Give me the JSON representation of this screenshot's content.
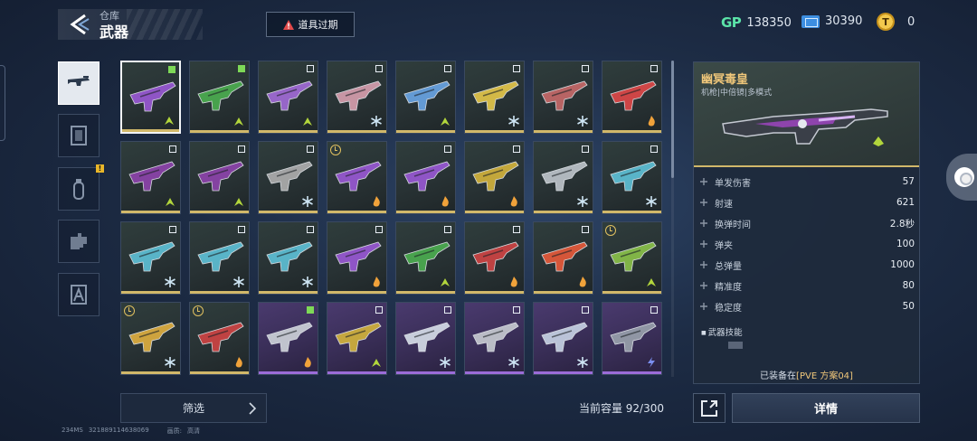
{
  "header": {
    "subtitle": "仓库",
    "title": "武器",
    "expired_label": "道具过期"
  },
  "currency": {
    "gp_label": "GP",
    "gp_value": "138350",
    "ticket_value": "30390",
    "coin_value": "0"
  },
  "categories": [
    {
      "icon": "rifle-icon",
      "active": true
    },
    {
      "icon": "frame-icon",
      "active": false
    },
    {
      "icon": "grenade-icon",
      "active": false,
      "badge": "!"
    },
    {
      "icon": "puzzle-icon",
      "active": false
    },
    {
      "icon": "character-icon",
      "active": false
    }
  ],
  "grid": {
    "items": [
      {
        "selected": true,
        "corner": "green",
        "elem": "poison",
        "rarity": "gold",
        "color": "#9b59d6"
      },
      {
        "corner": "green",
        "elem": "poison",
        "rarity": "gold",
        "color": "#4caf50"
      },
      {
        "corner": "empty",
        "elem": "poison",
        "rarity": "gold",
        "color": "#a36cd9"
      },
      {
        "corner": "empty",
        "elem": "ice",
        "rarity": "gold",
        "color": "#d9a0b0"
      },
      {
        "corner": "empty",
        "elem": "poison",
        "rarity": "gold",
        "color": "#6aa6e6"
      },
      {
        "corner": "empty",
        "elem": "ice",
        "rarity": "gold",
        "color": "#e6c84a"
      },
      {
        "corner": "empty",
        "elem": "ice",
        "rarity": "gold",
        "color": "#c86a6a"
      },
      {
        "corner": "empty",
        "elem": "fire",
        "rarity": "gold",
        "color": "#e04848"
      },
      {
        "corner": "empty",
        "elem": "poison",
        "rarity": "gold",
        "color": "#8e44ad"
      },
      {
        "corner": "empty",
        "elem": "poison",
        "rarity": "gold",
        "color": "#8e44ad"
      },
      {
        "corner": "empty",
        "elem": "ice",
        "rarity": "gold",
        "color": "#b0b0b0"
      },
      {
        "clock": true,
        "elem": "fire",
        "rarity": "gold",
        "color": "#9b59d6"
      },
      {
        "corner": "empty",
        "elem": "fire",
        "rarity": "gold",
        "color": "#9b59d6"
      },
      {
        "corner": "empty",
        "elem": "fire",
        "rarity": "gold",
        "color": "#d4b43c"
      },
      {
        "corner": "empty",
        "elem": "ice",
        "rarity": "gold",
        "color": "#bfc6cc"
      },
      {
        "corner": "empty",
        "elem": "ice",
        "rarity": "gold",
        "color": "#5fc2d8"
      },
      {
        "corner": "empty",
        "elem": "ice",
        "rarity": "gold",
        "color": "#5fc2d8"
      },
      {
        "corner": "empty",
        "elem": "ice",
        "rarity": "gold",
        "color": "#5fc2d8"
      },
      {
        "corner": "empty",
        "elem": "ice",
        "rarity": "gold",
        "color": "#5fc2d8"
      },
      {
        "corner": "empty",
        "elem": "fire",
        "rarity": "gold",
        "color": "#9b59d6"
      },
      {
        "corner": "empty",
        "elem": "poison",
        "rarity": "gold",
        "color": "#4caf50"
      },
      {
        "corner": "empty",
        "elem": "fire",
        "rarity": "gold",
        "color": "#d04444"
      },
      {
        "corner": "empty",
        "elem": "fire",
        "rarity": "gold",
        "color": "#e85a3a"
      },
      {
        "clock": true,
        "elem": "poison",
        "rarity": "gold",
        "color": "#8bc34a"
      },
      {
        "clock": true,
        "elem": "ice",
        "rarity": "gold",
        "color": "#e0b040"
      },
      {
        "clock": true,
        "elem": "fire",
        "rarity": "gold",
        "color": "#d04444"
      },
      {
        "corner": "green",
        "elem": "fire",
        "rarity": "purple",
        "color": "#cfd4da"
      },
      {
        "corner": "empty",
        "elem": "poison",
        "rarity": "purple",
        "color": "#d4b43c"
      },
      {
        "corner": "empty",
        "elem": "ice",
        "rarity": "purple",
        "color": "#d8e0ea"
      },
      {
        "corner": "empty",
        "elem": "ice",
        "rarity": "purple",
        "color": "#c8ccd2"
      },
      {
        "corner": "empty",
        "elem": "ice",
        "rarity": "purple",
        "color": "#c8d4e6"
      },
      {
        "corner": "empty",
        "elem": "bolt",
        "rarity": "purple",
        "color": "#9aa2ad"
      }
    ]
  },
  "footer": {
    "filter_label": "筛选",
    "capacity": "当前容量 92/300",
    "ping": "234MS",
    "id": "321889114638069",
    "quality_label": "画质:",
    "quality_value": "高清"
  },
  "detail": {
    "name": "幽冥毒皇",
    "subtitle": "机枪|中倍镜|多模式",
    "stats": [
      {
        "label": "单发伤害",
        "value": "57",
        "icon": "damage-icon"
      },
      {
        "label": "射速",
        "value": "621",
        "icon": "fire-rate-icon"
      },
      {
        "label": "换弹时间",
        "value": "2.8秒",
        "icon": "reload-icon"
      },
      {
        "label": "弹夹",
        "value": "100",
        "icon": "magazine-icon"
      },
      {
        "label": "总弹量",
        "value": "1000",
        "icon": "ammo-icon"
      },
      {
        "label": "精准度",
        "value": "80",
        "icon": "accuracy-icon"
      },
      {
        "label": "稳定度",
        "value": "50",
        "icon": "stability-icon"
      }
    ],
    "skill_title": "武器技能",
    "equipped_prefix": "已装备在",
    "equipped_plan": "[PVE 方案04]",
    "detail_button": "详情"
  },
  "colors": {
    "gold": "#d1b86a",
    "purple": "#9b6cd8",
    "accent_text": "#f0c77a"
  }
}
